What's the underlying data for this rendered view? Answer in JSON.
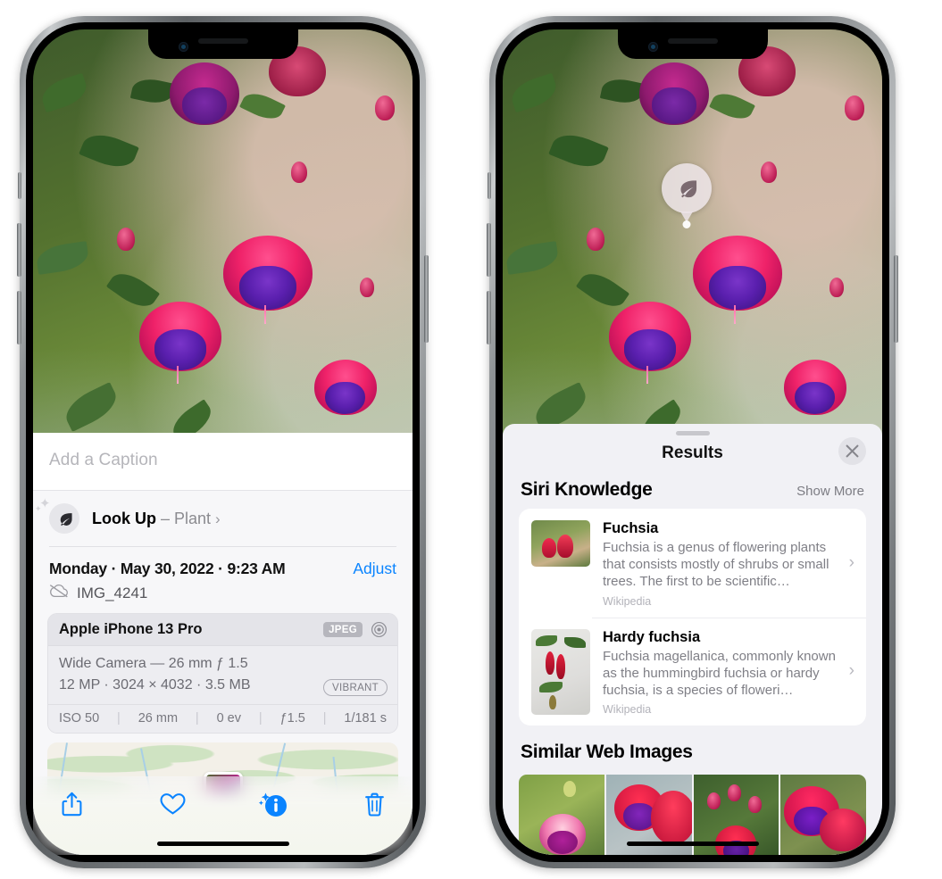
{
  "left_phone": {
    "caption": {
      "placeholder": "Add a Caption",
      "value": ""
    },
    "look_up": {
      "label": "Look Up",
      "dash": "–",
      "subject": "Plant",
      "chevron": "›",
      "icon": "leaf-icon"
    },
    "date_row": {
      "date": "Monday · May 30, 2022 · 9:23 AM",
      "adjust": "Adjust"
    },
    "filename": {
      "text": "IMG_4241",
      "icon": "cloud-slash-icon"
    },
    "metadata": {
      "device": "Apple iPhone 13 Pro",
      "format_badge": "JPEG",
      "aperture_icon": "aperture-icon",
      "lens_line": "Wide Camera — 26 mm ƒ 1.5",
      "size_line": "12 MP · 3024 × 4032 · 3.5 MB",
      "style_pill": "VIBRANT",
      "exif": [
        "ISO 50",
        "26 mm",
        "0 ev",
        "ƒ1.5",
        "1/181 s"
      ],
      "exif_separator": "|"
    },
    "toolbar": {
      "share": "share-icon",
      "favorite": "heart-icon",
      "info": "info-sparkle-icon",
      "delete": "trash-icon"
    },
    "accent_color": "#0a84ff"
  },
  "right_phone": {
    "visual_lookup_badge": {
      "icon": "leaf-icon"
    },
    "sheet": {
      "title": "Results",
      "close": "close-icon",
      "sections": [
        {
          "title": "Siri Knowledge",
          "action": "Show More",
          "items": [
            {
              "title": "Fuchsia",
              "description": "Fuchsia is a genus of flowering plants that consists mostly of shrubs or small trees. The first to be scientific…",
              "source": "Wikipedia",
              "chevron": "›"
            },
            {
              "title": "Hardy fuchsia",
              "description": "Fuchsia magellanica, commonly known as the hummingbird fuchsia or hardy fuchsia, is a species of floweri…",
              "source": "Wikipedia",
              "chevron": "›"
            }
          ]
        },
        {
          "title": "Similar Web Images",
          "action": "",
          "thumbnails": [
            "web-image-1",
            "web-image-2",
            "web-image-3",
            "web-image-4"
          ]
        }
      ]
    }
  }
}
